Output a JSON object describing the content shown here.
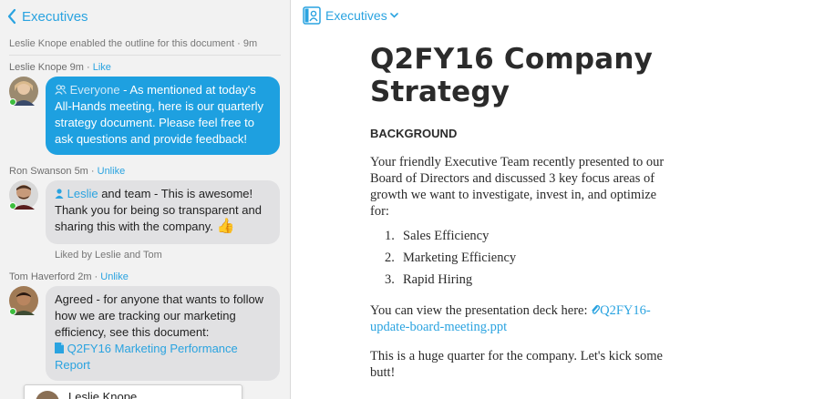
{
  "left": {
    "back_label": "Executives",
    "system_note": "Leslie Knope enabled the outline for this document · 9m",
    "messages": [
      {
        "author": "Leslie Knope",
        "time": "9m",
        "action": "Like",
        "mention": "Everyone",
        "text": " - As mentioned at today's All-Hands meeting, here is our quarterly strategy document. Please feel free to ask questions and provide feedback!"
      },
      {
        "author": "Ron Swanson",
        "time": "5m",
        "action": "Unlike",
        "mention": "Leslie",
        "text": " and team - This is awesome! Thank you for being so transparent and sharing this with the company.",
        "emoji": "👍",
        "liked_by": "Liked by Leslie and Tom"
      },
      {
        "author": "Tom Haverford",
        "time": "2m",
        "action": "Unlike",
        "text": "Agreed - for anyone that wants to follow how we are tracking our marketing efficiency, see this document:",
        "doc_link": "Q2FY16 Marketing Performance Report"
      }
    ],
    "partial_card_name": "Leslie Knope"
  },
  "right": {
    "folder": "Executives",
    "title": "Q2FY16 Company Strategy",
    "section_heading": "BACKGROUND",
    "para1": "Your friendly Executive Team recently presented to our Board of Directors and discussed 3 key focus areas of growth we want to investigate, invest in, and optimize for:",
    "list": [
      {
        "num": "1.",
        "text": "Sales Efficiency"
      },
      {
        "num": "2.",
        "text": "Marketing Efficiency"
      },
      {
        "num": "3.",
        "text": "Rapid Hiring"
      }
    ],
    "para2_prefix": "You can view the presentation deck here: ",
    "para2_link": "Q2FY16-update-board-meeting.ppt",
    "para3": "This is a huge quarter for the company. Let's kick some butt!"
  },
  "colors": {
    "accent": "#2aa3e0",
    "bubble_blue": "#1ea0e0",
    "bubble_gray": "#e1e1e3",
    "online": "#3dbd3d"
  }
}
